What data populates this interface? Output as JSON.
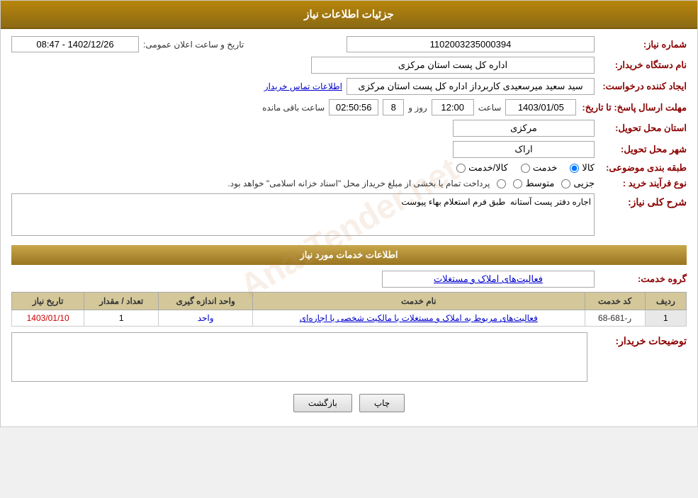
{
  "header": {
    "title": "جزئیات اطلاعات نیاز"
  },
  "form": {
    "shomara_niaz_label": "شماره نیاز:",
    "shomara_niaz_value": "1102003235000394",
    "name_dasgah_label": "نام دستگاه خریدار:",
    "name_dasgah_value": "اداره کل پست استان مرکزی",
    "tarikh_elan_label": "تاریخ و ساعت اعلان عمومی:",
    "tarikh_elan_value": "1402/12/26 - 08:47",
    "ijad_label": "ایجاد کننده درخواست:",
    "ijad_value": "سید سعید میرسعیدی کاربرداز اداره کل پست استان مرکزی",
    "etelaat_tamas_label": "اطلاعات تماس خریدار",
    "mohlet_label": "مهلت ارسال پاسخ: تا تاریخ:",
    "mohlet_date_value": "1403/01/05",
    "mohlet_saat_label": "ساعت",
    "mohlet_saat_value": "12:00",
    "mohlet_rooz_label": "روز و",
    "mohlet_rooz_value": "8",
    "mohlet_baqi_label": "ساعت باقی مانده",
    "mohlet_baqi_value": "02:50:56",
    "ostan_label": "استان محل تحویل:",
    "ostan_value": "مرکزی",
    "shahr_label": "شهر محل تحویل:",
    "shahr_value": "اراک",
    "tabaghebandi_label": "طبقه بندی موضوعی:",
    "tabaghebandi_options": [
      {
        "value": "kala",
        "label": "کالا"
      },
      {
        "value": "khadamat",
        "label": "خدمت"
      },
      {
        "value": "kala_khadamat",
        "label": "کالا/خدمت"
      }
    ],
    "tabaghebandi_selected": "kala",
    "noee_farayand_label": "نوع فرآیند خرید :",
    "noee_farayand_options": [
      {
        "value": "jozyi",
        "label": "جزیی"
      },
      {
        "value": "motawaset",
        "label": "متوسط"
      },
      {
        "value": "other",
        "label": ""
      }
    ],
    "noee_farayand_text": "پرداخت تمام یا بخشی از مبلغ خریداز محل \"اسناد خزانه اسلامی\" خواهد بود.",
    "sharh_label": "شرح کلی نیاز:",
    "sharh_value": "اجاره دفتر پست آستانه  طبق فرم استعلام بهاء پیوست",
    "khadamat_section_title": "اطلاعات خدمات مورد نیاز",
    "gorooh_khadamat_label": "گروه خدمت:",
    "gorooh_khadamat_value": "فعالیت‌های  املاک و مستغلات",
    "table": {
      "headers": [
        "ردیف",
        "کد خدمت",
        "نام خدمت",
        "واحد اندازه گیری",
        "تعداد / مقدار",
        "تاریخ نیاز"
      ],
      "rows": [
        {
          "radif": "1",
          "kod": "ر-681-68",
          "naam": "فعالیت‌های مربوط به املاک و مستغلات با مالکیت شخصی یا اجاره‌ای",
          "vahed": "واحد",
          "tedad": "1",
          "tarikh": "1403/01/10"
        }
      ]
    },
    "tawsiyat_label": "توضیحات خریدار:",
    "tawsiyat_value": "",
    "buttons": {
      "chap": "چاپ",
      "bazgasht": "بازگشت"
    }
  }
}
